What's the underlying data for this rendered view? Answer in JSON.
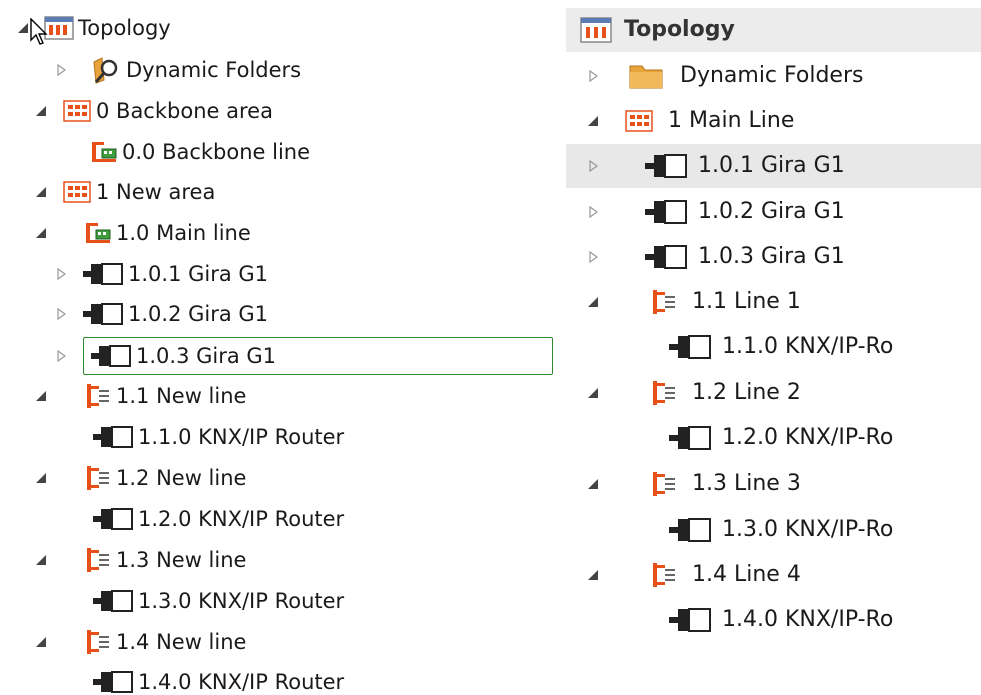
{
  "left_tree": {
    "root": "Topology",
    "items": [
      "Dynamic Folders",
      "0 Backbone area",
      "0.0 Backbone line",
      "1 New area",
      "1.0 Main line",
      "1.0.1  Gira G1",
      "1.0.2  Gira G1",
      "1.0.3  Gira G1",
      "1.1 New line",
      "1.1.0  KNX/IP Router",
      "1.2 New line",
      "1.2.0  KNX/IP Router",
      "1.3 New line",
      "1.3.0  KNX/IP Router",
      "1.4 New line",
      "1.4.0  KNX/IP Router"
    ]
  },
  "right_tree": {
    "header": "Topology",
    "items": [
      "Dynamic Folders",
      "1 Main Line",
      "1.0.1 Gira G1",
      "1.0.2 Gira G1",
      "1.0.3 Gira G1",
      "1.1 Line 1",
      "1.1.0 KNX/IP-Ro",
      "1.2 Line 2",
      "1.2.0 KNX/IP-Ro",
      "1.3 Line 3",
      "1.3.0 KNX/IP-Ro",
      "1.4 Line 4",
      "1.4.0 KNX/IP-Ro"
    ]
  },
  "colors": {
    "accent_orange": "#e8501a",
    "folder_gold": "#e8a33a",
    "selection_border": "#2f8a2f",
    "hover_bg": "#e8e8e8",
    "header_bg": "#ececec"
  }
}
